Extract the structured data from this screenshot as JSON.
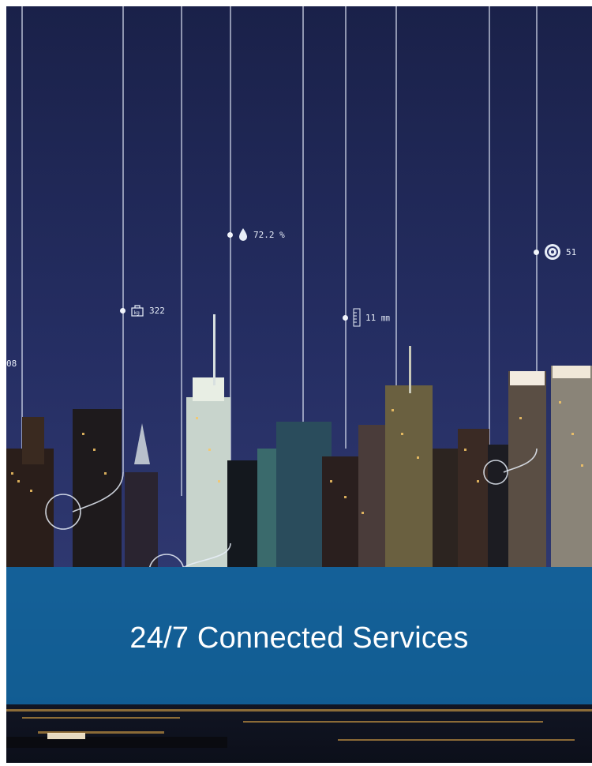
{
  "banner": {
    "title": "24/7 Connected Services"
  },
  "metrics": {
    "weight_value": "322",
    "humidity_value": "72.2 %",
    "level_value": "11 ㎜",
    "speed_value": "51",
    "edge_value": "08"
  },
  "icons": [
    "weight-icon",
    "water-drop-icon",
    "level-gauge-icon",
    "target-icon"
  ],
  "colors": {
    "sky_top": "#1b2450",
    "sky_mid": "#263066",
    "banner_blue": "#1278be",
    "city_lights": "#f7c766"
  }
}
